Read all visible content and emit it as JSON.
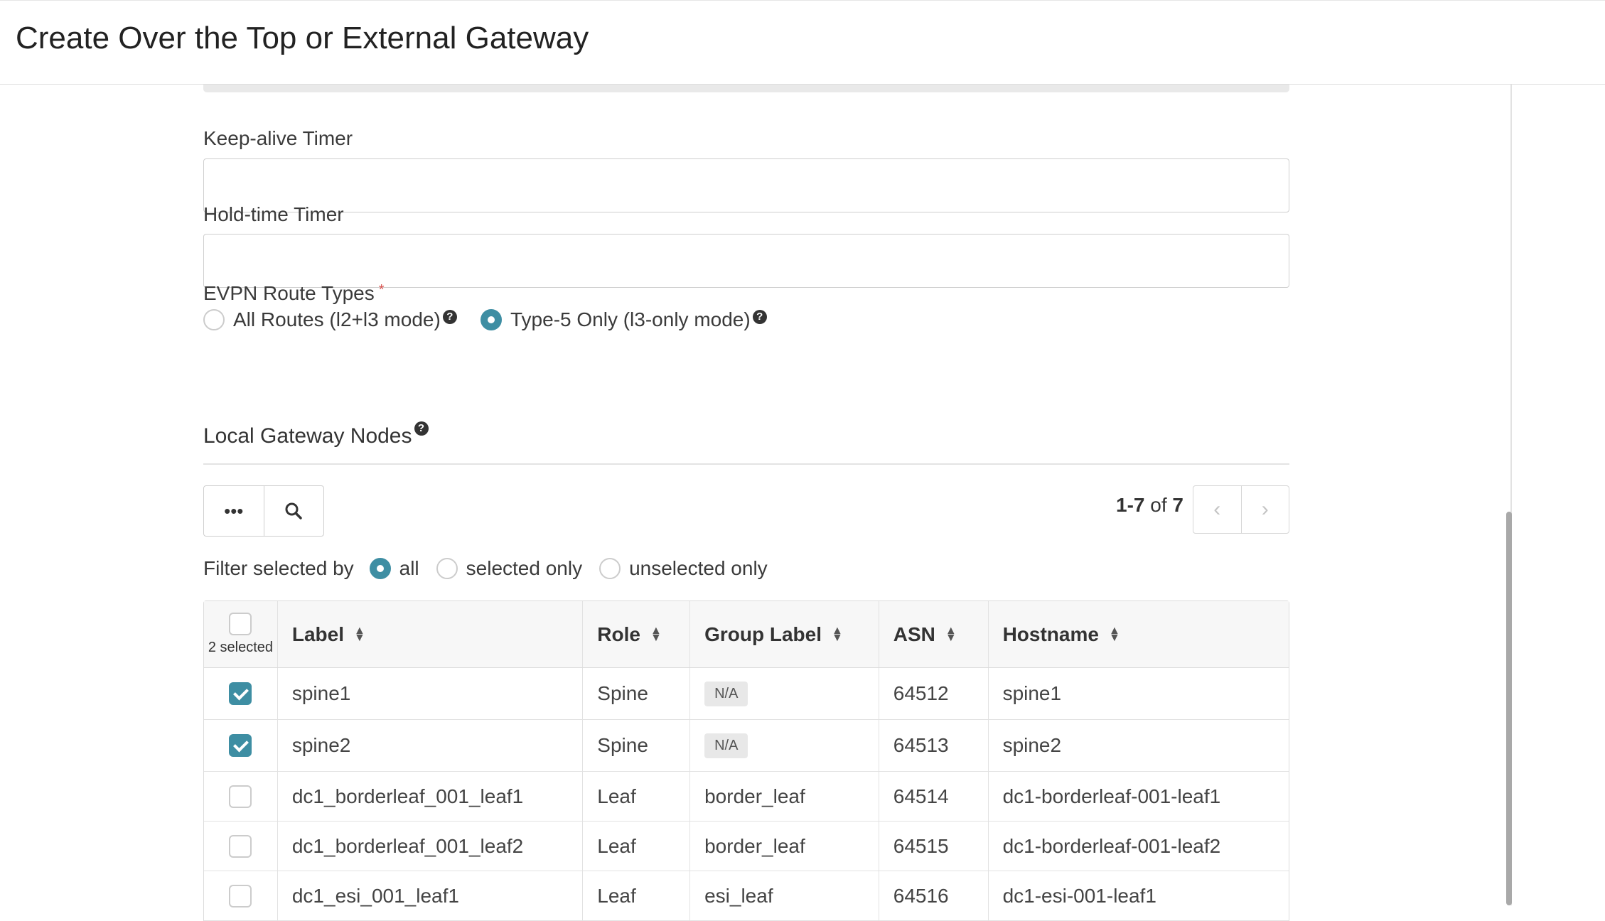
{
  "header": {
    "title": "Create Over the Top or External Gateway"
  },
  "form": {
    "keepalive_label": "Keep-alive Timer",
    "keepalive_value": "",
    "holdtime_label": "Hold-time Timer",
    "holdtime_value": "",
    "evpn_label": "EVPN Route Types",
    "evpn_required": "*",
    "evpn_options": [
      {
        "label": "All Routes (l2+l3 mode)",
        "selected": false
      },
      {
        "label": "Type-5 Only (l3-only mode)",
        "selected": true
      }
    ]
  },
  "nodes": {
    "title": "Local Gateway Nodes",
    "more_icon": "more-icon",
    "search_icon": "search-icon",
    "pager": {
      "range": "1-7",
      "of": "of",
      "total": "7"
    },
    "filter": {
      "label": "Filter selected by",
      "options": [
        {
          "label": "all",
          "selected": true
        },
        {
          "label": "selected only",
          "selected": false
        },
        {
          "label": "unselected only",
          "selected": false
        }
      ]
    },
    "table": {
      "selected_count": "2 selected",
      "columns": [
        "Label",
        "Role",
        "Group Label",
        "ASN",
        "Hostname"
      ],
      "rows": [
        {
          "checked": true,
          "label": "spine1",
          "role": "Spine",
          "group": "N/A",
          "group_badge": true,
          "asn": "64512",
          "hostname": "spine1"
        },
        {
          "checked": true,
          "label": "spine2",
          "role": "Spine",
          "group": "N/A",
          "group_badge": true,
          "asn": "64513",
          "hostname": "spine2"
        },
        {
          "checked": false,
          "label": "dc1_borderleaf_001_leaf1",
          "role": "Leaf",
          "group": "border_leaf",
          "group_badge": false,
          "asn": "64514",
          "hostname": "dc1-borderleaf-001-leaf1"
        },
        {
          "checked": false,
          "label": "dc1_borderleaf_001_leaf2",
          "role": "Leaf",
          "group": "border_leaf",
          "group_badge": false,
          "asn": "64515",
          "hostname": "dc1-borderleaf-001-leaf2"
        },
        {
          "checked": false,
          "label": "dc1_esi_001_leaf1",
          "role": "Leaf",
          "group": "esi_leaf",
          "group_badge": false,
          "asn": "64516",
          "hostname": "dc1-esi-001-leaf1"
        }
      ]
    }
  },
  "colors": {
    "accent": "#3e8ea3",
    "required": "#d9534f"
  }
}
